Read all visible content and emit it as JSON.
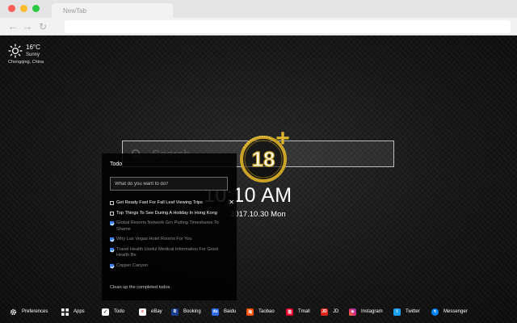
{
  "browser": {
    "tab_title": "NewTab"
  },
  "weather": {
    "temperature": "16°C",
    "condition": "Sunny",
    "location": "Chongqing,  China"
  },
  "search": {
    "placeholder": "Search"
  },
  "clock": {
    "time": "10:10 AM",
    "date": "2017.10.30 Mon"
  },
  "badge": {
    "text": "18",
    "plus": "+"
  },
  "todo": {
    "title": "Todo",
    "input_placeholder": "What do you want to do?",
    "items": [
      {
        "text": "Get Ready Fast For Fall Leaf Viewing Trips",
        "done": false
      },
      {
        "text": "Top Things To See During A Holiday In Hong Kong",
        "done": false
      },
      {
        "text": "Global Resorts Network Grn Putting Timeshares To Shame",
        "done": true
      },
      {
        "text": "Why Las Vegas Hotel Rooms For You",
        "done": true
      },
      {
        "text": "Travel Health Useful Medical Information For Good Health Be",
        "done": true
      },
      {
        "text": "Copper Canyon",
        "done": true
      }
    ],
    "clear_label": "Clean up the completed todos"
  },
  "bottom_bar": {
    "preferences": "Preferences",
    "apps": "Apps",
    "todo": "Todo",
    "links": [
      {
        "label": "eBay",
        "color": "#ffffff"
      },
      {
        "label": "Booking",
        "color": "#1b3f8f"
      },
      {
        "label": "Baidu",
        "color": "#2d6ae3"
      },
      {
        "label": "Taobao",
        "color": "#ff5000"
      },
      {
        "label": "Tmall",
        "color": "#e4002b"
      },
      {
        "label": "JD",
        "color": "#e1251b"
      },
      {
        "label": "Instagram",
        "color": "#c13584"
      },
      {
        "label": "Twitter",
        "color": "#1da1f2"
      },
      {
        "label": "Messenger",
        "color": "#0084ff"
      }
    ]
  }
}
